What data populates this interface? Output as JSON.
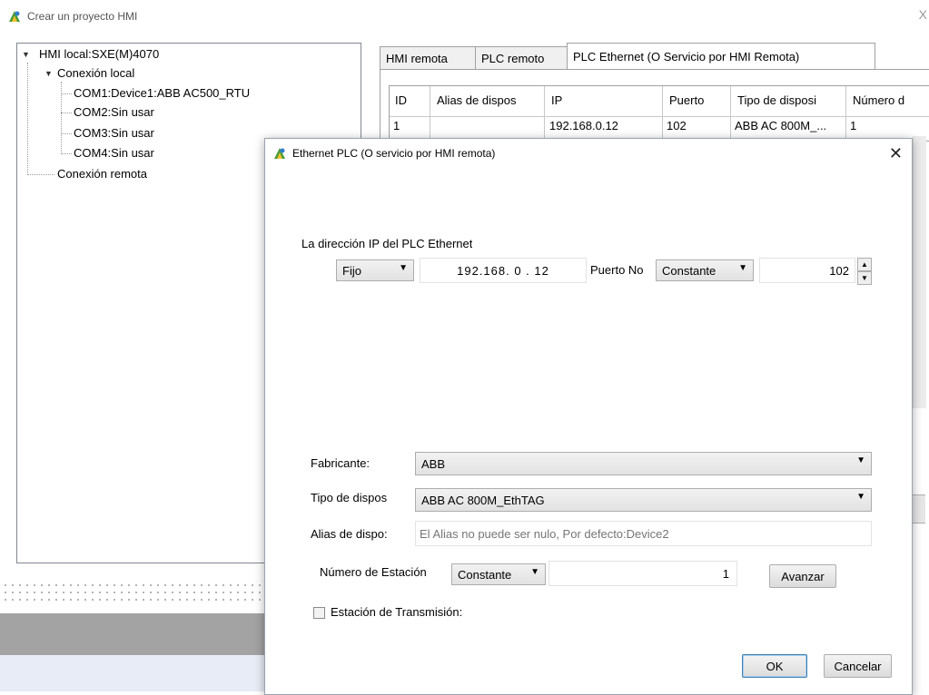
{
  "main_window": {
    "title": "Crear un proyecto HMI",
    "close": "X"
  },
  "tree": {
    "root": "HMI local:SXE(M)4070",
    "local": "Conexión local",
    "com_items": [
      "COM1:Device1:ABB AC500_RTU",
      "COM2:Sin usar",
      "COM3:Sin usar",
      "COM4:Sin usar"
    ],
    "remote": "Conexión remota"
  },
  "tabs": [
    {
      "label": "HMI remota"
    },
    {
      "label": "PLC remoto"
    },
    {
      "label": "PLC Ethernet (O Servicio por HMI Remota)"
    }
  ],
  "grid": {
    "columns": [
      "ID",
      "Alias de dispos",
      "IP",
      "Puerto",
      "Tipo de disposi",
      "Número d"
    ],
    "rows": [
      [
        "1",
        "",
        "192.168.0.12",
        "102",
        "ABB AC 800M_...",
        "1"
      ]
    ]
  },
  "dialog": {
    "title": "Ethernet PLC (O servicio por HMI remota)",
    "close": "✕",
    "ip_section_label": "La dirección IP del PLC Ethernet",
    "ip_mode": "Fijo",
    "ip_value": "192.168. 0 . 12",
    "port_label": "Puerto No",
    "port_mode": "Constante",
    "port_value": "102",
    "manufacturer_label": "Fabricante:",
    "manufacturer_value": "ABB",
    "device_type_label": "Tipo de dispos",
    "device_type_value": "ABB AC 800M_EthTAG",
    "alias_label": "Alias de dispo:",
    "alias_placeholder": "El Alias no puede ser nulo, Por defecto:Device2",
    "station_label": "Número de Estación",
    "station_mode": "Constante",
    "station_value": "1",
    "advance_button": "Avanzar",
    "broadcast_label": "Estación de Transmisión:",
    "ok_button": "OK",
    "cancel_button": "Cancelar"
  }
}
